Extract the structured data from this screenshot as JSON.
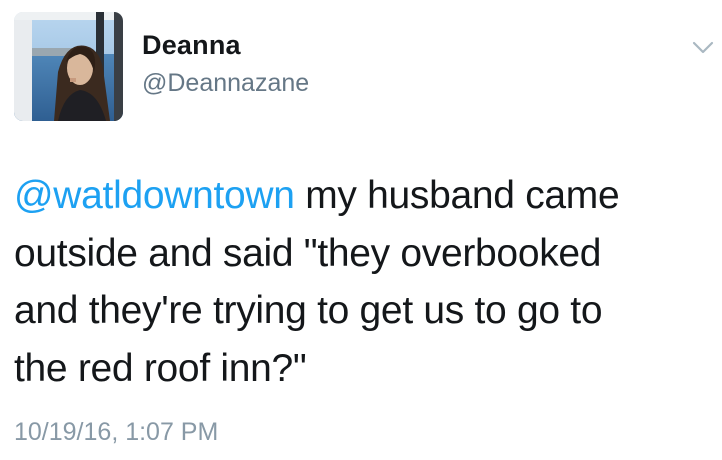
{
  "tweet": {
    "author": {
      "display_name": "Deanna",
      "handle": "@Deannazane",
      "avatar_icon": "profile-photo"
    },
    "menu_icon": "chevron-down-icon",
    "body": {
      "mention": "@watldowntown",
      "text_line_1": " my husband came",
      "text_line_2": "outside and said \"they overbooked",
      "text_line_3": "and they're trying to get us to go to",
      "text_line_4": "the red roof inn?\""
    },
    "timestamp": "10/19/16, 1:07 PM"
  },
  "colors": {
    "link": "#1da1f2",
    "text": "#14171a",
    "secondary": "#657786",
    "timestamp": "#8899a6"
  }
}
